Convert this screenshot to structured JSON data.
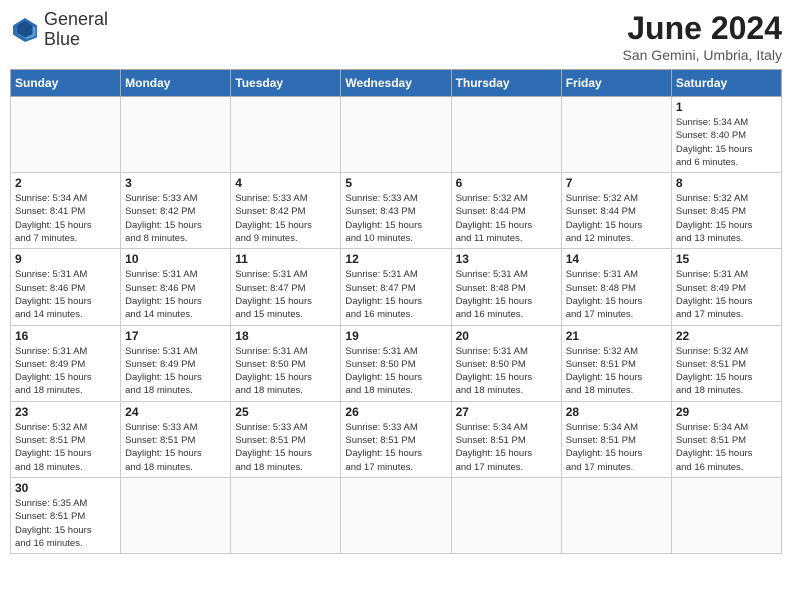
{
  "header": {
    "logo_line1": "General",
    "logo_line2": "Blue",
    "month_year": "June 2024",
    "location": "San Gemini, Umbria, Italy"
  },
  "days_of_week": [
    "Sunday",
    "Monday",
    "Tuesday",
    "Wednesday",
    "Thursday",
    "Friday",
    "Saturday"
  ],
  "weeks": [
    [
      {
        "day": "",
        "info": ""
      },
      {
        "day": "",
        "info": ""
      },
      {
        "day": "",
        "info": ""
      },
      {
        "day": "",
        "info": ""
      },
      {
        "day": "",
        "info": ""
      },
      {
        "day": "",
        "info": ""
      },
      {
        "day": "1",
        "info": "Sunrise: 5:34 AM\nSunset: 8:40 PM\nDaylight: 15 hours\nand 6 minutes."
      }
    ],
    [
      {
        "day": "2",
        "info": "Sunrise: 5:34 AM\nSunset: 8:41 PM\nDaylight: 15 hours\nand 7 minutes."
      },
      {
        "day": "3",
        "info": "Sunrise: 5:33 AM\nSunset: 8:42 PM\nDaylight: 15 hours\nand 8 minutes."
      },
      {
        "day": "4",
        "info": "Sunrise: 5:33 AM\nSunset: 8:42 PM\nDaylight: 15 hours\nand 9 minutes."
      },
      {
        "day": "5",
        "info": "Sunrise: 5:33 AM\nSunset: 8:43 PM\nDaylight: 15 hours\nand 10 minutes."
      },
      {
        "day": "6",
        "info": "Sunrise: 5:32 AM\nSunset: 8:44 PM\nDaylight: 15 hours\nand 11 minutes."
      },
      {
        "day": "7",
        "info": "Sunrise: 5:32 AM\nSunset: 8:44 PM\nDaylight: 15 hours\nand 12 minutes."
      },
      {
        "day": "8",
        "info": "Sunrise: 5:32 AM\nSunset: 8:45 PM\nDaylight: 15 hours\nand 13 minutes."
      }
    ],
    [
      {
        "day": "9",
        "info": "Sunrise: 5:31 AM\nSunset: 8:46 PM\nDaylight: 15 hours\nand 14 minutes."
      },
      {
        "day": "10",
        "info": "Sunrise: 5:31 AM\nSunset: 8:46 PM\nDaylight: 15 hours\nand 14 minutes."
      },
      {
        "day": "11",
        "info": "Sunrise: 5:31 AM\nSunset: 8:47 PM\nDaylight: 15 hours\nand 15 minutes."
      },
      {
        "day": "12",
        "info": "Sunrise: 5:31 AM\nSunset: 8:47 PM\nDaylight: 15 hours\nand 16 minutes."
      },
      {
        "day": "13",
        "info": "Sunrise: 5:31 AM\nSunset: 8:48 PM\nDaylight: 15 hours\nand 16 minutes."
      },
      {
        "day": "14",
        "info": "Sunrise: 5:31 AM\nSunset: 8:48 PM\nDaylight: 15 hours\nand 17 minutes."
      },
      {
        "day": "15",
        "info": "Sunrise: 5:31 AM\nSunset: 8:49 PM\nDaylight: 15 hours\nand 17 minutes."
      }
    ],
    [
      {
        "day": "16",
        "info": "Sunrise: 5:31 AM\nSunset: 8:49 PM\nDaylight: 15 hours\nand 18 minutes."
      },
      {
        "day": "17",
        "info": "Sunrise: 5:31 AM\nSunset: 8:49 PM\nDaylight: 15 hours\nand 18 minutes."
      },
      {
        "day": "18",
        "info": "Sunrise: 5:31 AM\nSunset: 8:50 PM\nDaylight: 15 hours\nand 18 minutes."
      },
      {
        "day": "19",
        "info": "Sunrise: 5:31 AM\nSunset: 8:50 PM\nDaylight: 15 hours\nand 18 minutes."
      },
      {
        "day": "20",
        "info": "Sunrise: 5:31 AM\nSunset: 8:50 PM\nDaylight: 15 hours\nand 18 minutes."
      },
      {
        "day": "21",
        "info": "Sunrise: 5:32 AM\nSunset: 8:51 PM\nDaylight: 15 hours\nand 18 minutes."
      },
      {
        "day": "22",
        "info": "Sunrise: 5:32 AM\nSunset: 8:51 PM\nDaylight: 15 hours\nand 18 minutes."
      }
    ],
    [
      {
        "day": "23",
        "info": "Sunrise: 5:32 AM\nSunset: 8:51 PM\nDaylight: 15 hours\nand 18 minutes."
      },
      {
        "day": "24",
        "info": "Sunrise: 5:33 AM\nSunset: 8:51 PM\nDaylight: 15 hours\nand 18 minutes."
      },
      {
        "day": "25",
        "info": "Sunrise: 5:33 AM\nSunset: 8:51 PM\nDaylight: 15 hours\nand 18 minutes."
      },
      {
        "day": "26",
        "info": "Sunrise: 5:33 AM\nSunset: 8:51 PM\nDaylight: 15 hours\nand 17 minutes."
      },
      {
        "day": "27",
        "info": "Sunrise: 5:34 AM\nSunset: 8:51 PM\nDaylight: 15 hours\nand 17 minutes."
      },
      {
        "day": "28",
        "info": "Sunrise: 5:34 AM\nSunset: 8:51 PM\nDaylight: 15 hours\nand 17 minutes."
      },
      {
        "day": "29",
        "info": "Sunrise: 5:34 AM\nSunset: 8:51 PM\nDaylight: 15 hours\nand 16 minutes."
      }
    ],
    [
      {
        "day": "30",
        "info": "Sunrise: 5:35 AM\nSunset: 8:51 PM\nDaylight: 15 hours\nand 16 minutes."
      },
      {
        "day": "",
        "info": ""
      },
      {
        "day": "",
        "info": ""
      },
      {
        "day": "",
        "info": ""
      },
      {
        "day": "",
        "info": ""
      },
      {
        "day": "",
        "info": ""
      },
      {
        "day": "",
        "info": ""
      }
    ]
  ]
}
